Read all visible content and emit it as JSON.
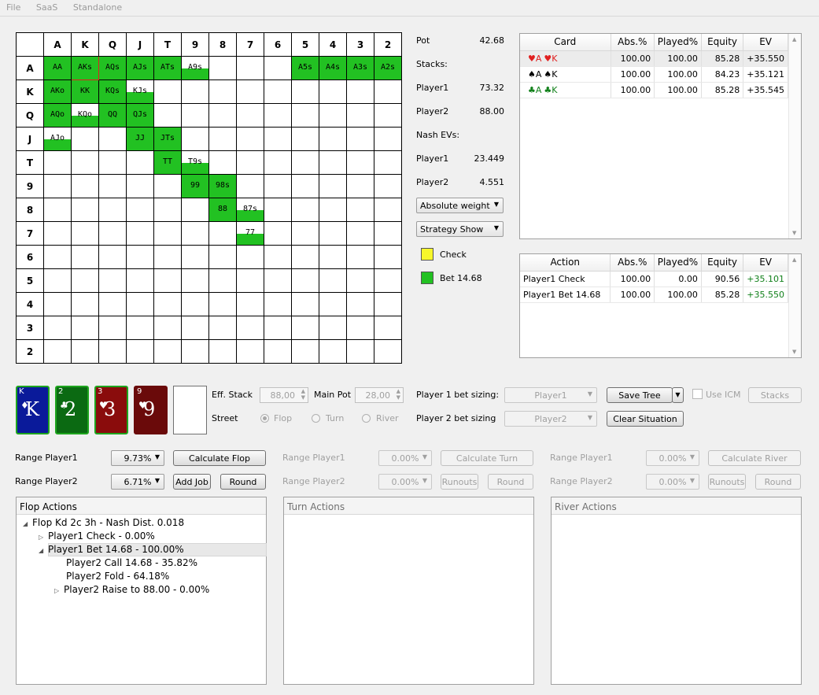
{
  "menu": [
    "File",
    "SaaS",
    "Standalone"
  ],
  "grid": {
    "headers": [
      "A",
      "K",
      "Q",
      "J",
      "T",
      "9",
      "8",
      "7",
      "6",
      "5",
      "4",
      "3",
      "2"
    ],
    "rows": [
      {
        "label": "A",
        "cells": [
          {
            "t": "AA",
            "f": 1
          },
          {
            "t": "AKs",
            "f": 1,
            "sel": true
          },
          {
            "t": "AQs",
            "f": 1
          },
          {
            "t": "AJs",
            "f": 1
          },
          {
            "t": "ATs",
            "f": 1
          },
          {
            "t": "A9s",
            "f": 0.5
          },
          {
            "t": "",
            "f": 0
          },
          {
            "t": "",
            "f": 0
          },
          {
            "t": "",
            "f": 0
          },
          {
            "t": "A5s",
            "f": 1
          },
          {
            "t": "A4s",
            "f": 1
          },
          {
            "t": "A3s",
            "f": 1
          },
          {
            "t": "A2s",
            "f": 1
          }
        ]
      },
      {
        "label": "K",
        "cells": [
          {
            "t": "AKo",
            "f": 1
          },
          {
            "t": "KK",
            "f": 1
          },
          {
            "t": "KQs",
            "f": 1
          },
          {
            "t": "KJs",
            "f": 0.5
          },
          {
            "t": "",
            "f": 0
          },
          {
            "t": "",
            "f": 0
          },
          {
            "t": "",
            "f": 0
          },
          {
            "t": "",
            "f": 0
          },
          {
            "t": "",
            "f": 0
          },
          {
            "t": "",
            "f": 0
          },
          {
            "t": "",
            "f": 0
          },
          {
            "t": "",
            "f": 0
          },
          {
            "t": "",
            "f": 0
          }
        ]
      },
      {
        "label": "Q",
        "cells": [
          {
            "t": "AQo",
            "f": 1
          },
          {
            "t": "KQo",
            "f": 0.5
          },
          {
            "t": "QQ",
            "f": 1
          },
          {
            "t": "QJs",
            "f": 1
          },
          {
            "t": "",
            "f": 0
          },
          {
            "t": "",
            "f": 0
          },
          {
            "t": "",
            "f": 0
          },
          {
            "t": "",
            "f": 0
          },
          {
            "t": "",
            "f": 0
          },
          {
            "t": "",
            "f": 0
          },
          {
            "t": "",
            "f": 0
          },
          {
            "t": "",
            "f": 0
          },
          {
            "t": "",
            "f": 0
          }
        ]
      },
      {
        "label": "J",
        "cells": [
          {
            "t": "AJo",
            "f": 0.5
          },
          {
            "t": "",
            "f": 0
          },
          {
            "t": "",
            "f": 0
          },
          {
            "t": "JJ",
            "f": 1
          },
          {
            "t": "JTs",
            "f": 1
          },
          {
            "t": "",
            "f": 0
          },
          {
            "t": "",
            "f": 0
          },
          {
            "t": "",
            "f": 0
          },
          {
            "t": "",
            "f": 0
          },
          {
            "t": "",
            "f": 0
          },
          {
            "t": "",
            "f": 0
          },
          {
            "t": "",
            "f": 0
          },
          {
            "t": "",
            "f": 0
          }
        ]
      },
      {
        "label": "T",
        "cells": [
          {
            "t": "",
            "f": 0
          },
          {
            "t": "",
            "f": 0
          },
          {
            "t": "",
            "f": 0
          },
          {
            "t": "",
            "f": 0
          },
          {
            "t": "TT",
            "f": 1
          },
          {
            "t": "T9s",
            "f": 0.5
          },
          {
            "t": "",
            "f": 0
          },
          {
            "t": "",
            "f": 0
          },
          {
            "t": "",
            "f": 0
          },
          {
            "t": "",
            "f": 0
          },
          {
            "t": "",
            "f": 0
          },
          {
            "t": "",
            "f": 0
          },
          {
            "t": "",
            "f": 0
          }
        ]
      },
      {
        "label": "9",
        "cells": [
          {
            "t": "",
            "f": 0
          },
          {
            "t": "",
            "f": 0
          },
          {
            "t": "",
            "f": 0
          },
          {
            "t": "",
            "f": 0
          },
          {
            "t": "",
            "f": 0
          },
          {
            "t": "99",
            "f": 1
          },
          {
            "t": "98s",
            "f": 1
          },
          {
            "t": "",
            "f": 0
          },
          {
            "t": "",
            "f": 0
          },
          {
            "t": "",
            "f": 0
          },
          {
            "t": "",
            "f": 0
          },
          {
            "t": "",
            "f": 0
          },
          {
            "t": "",
            "f": 0
          }
        ]
      },
      {
        "label": "8",
        "cells": [
          {
            "t": "",
            "f": 0
          },
          {
            "t": "",
            "f": 0
          },
          {
            "t": "",
            "f": 0
          },
          {
            "t": "",
            "f": 0
          },
          {
            "t": "",
            "f": 0
          },
          {
            "t": "",
            "f": 0
          },
          {
            "t": "88",
            "f": 1
          },
          {
            "t": "87s",
            "f": 0.5
          },
          {
            "t": "",
            "f": 0
          },
          {
            "t": "",
            "f": 0
          },
          {
            "t": "",
            "f": 0
          },
          {
            "t": "",
            "f": 0
          },
          {
            "t": "",
            "f": 0
          }
        ]
      },
      {
        "label": "7",
        "cells": [
          {
            "t": "",
            "f": 0
          },
          {
            "t": "",
            "f": 0
          },
          {
            "t": "",
            "f": 0
          },
          {
            "t": "",
            "f": 0
          },
          {
            "t": "",
            "f": 0
          },
          {
            "t": "",
            "f": 0
          },
          {
            "t": "",
            "f": 0
          },
          {
            "t": "77",
            "f": 0.5
          },
          {
            "t": "",
            "f": 0
          },
          {
            "t": "",
            "f": 0
          },
          {
            "t": "",
            "f": 0
          },
          {
            "t": "",
            "f": 0
          },
          {
            "t": "",
            "f": 0
          }
        ]
      },
      {
        "label": "6",
        "cells": []
      },
      {
        "label": "5",
        "cells": []
      },
      {
        "label": "4",
        "cells": []
      },
      {
        "label": "3",
        "cells": []
      },
      {
        "label": "2",
        "cells": []
      }
    ]
  },
  "info": {
    "pot_label": "Pot",
    "pot": "42.68",
    "stacks_label": "Stacks:",
    "p1_label": "Player1",
    "p1_stack": "73.32",
    "p2_label": "Player2",
    "p2_stack": "88.00",
    "nash_label": "Nash EVs:",
    "p1_ev_label": "Player1",
    "p1_ev": "23.449",
    "p2_ev_label": "Player2",
    "p2_ev": "4.551",
    "weight_combo": "Absolute weight",
    "strategy_combo": "Strategy Show",
    "legend_check": "Check",
    "legend_check_color": "#f7f72a",
    "legend_bet": "Bet 14.68",
    "legend_bet_color": "#22c122"
  },
  "card_table": {
    "headers": [
      "Card",
      "Abs.%",
      "Played%",
      "Equity",
      "EV"
    ],
    "rows": [
      {
        "s1": "♥",
        "r1": "A",
        "s2": "♥",
        "r2": "K",
        "color": "#e02020",
        "abs": "100.00",
        "played": "100.00",
        "equity": "85.28",
        "ev": "+35.550"
      },
      {
        "s1": "♠",
        "r1": "A",
        "s2": "♠",
        "r2": "K",
        "color": "#000000",
        "abs": "100.00",
        "played": "100.00",
        "equity": "84.23",
        "ev": "+35.121"
      },
      {
        "s1": "♣",
        "r1": "A",
        "s2": "♣",
        "r2": "K",
        "color": "#11801a",
        "abs": "100.00",
        "played": "100.00",
        "equity": "85.28",
        "ev": "+35.545"
      }
    ]
  },
  "action_table": {
    "headers": [
      "Action",
      "Abs.%",
      "Played%",
      "Equity",
      "EV"
    ],
    "rows": [
      {
        "action": "Player1 Check",
        "abs": "100.00",
        "played": "0.00",
        "equity": "90.56",
        "ev": "+35.101"
      },
      {
        "action": "Player1 Bet 14.68",
        "abs": "100.00",
        "played": "100.00",
        "equity": "85.28",
        "ev": "+35.550"
      }
    ]
  },
  "board": [
    {
      "rank": "K",
      "suit": "♦",
      "bg": "#0a1a9a"
    },
    {
      "rank": "2",
      "suit": "♣",
      "bg": "#0b6a12"
    },
    {
      "rank": "3",
      "suit": "♥",
      "bg": "#8a0c0c"
    },
    {
      "rank": "9",
      "suit": "♥",
      "bg": "#6a0a0a"
    }
  ],
  "settings": {
    "eff_stack_label": "Eff. Stack",
    "eff_stack": "88,00",
    "main_pot_label": "Main Pot",
    "main_pot": "28,00",
    "street_label": "Street",
    "flop": "Flop",
    "turn": "Turn",
    "river": "River",
    "p1_sizing_label": "Player 1 bet sizing:",
    "p1_sizing": "Player1",
    "p2_sizing_label": "Player 2 bet sizing",
    "p2_sizing": "Player2",
    "save_tree": "Save Tree",
    "clear_situation": "Clear Situation",
    "use_icm": "Use ICM",
    "stacks": "Stacks"
  },
  "flop_controls": {
    "range_p1_label": "Range Player1",
    "range_p1": "9.73%",
    "range_p2_label": "Range Player2",
    "range_p2": "6.71%",
    "calculate": "Calculate Flop",
    "add_job": "Add Job",
    "round": "Round"
  },
  "turn_controls": {
    "range_p1_label": "Range Player1",
    "range_p1": "0.00%",
    "range_p2_label": "Range Player2",
    "range_p2": "0.00%",
    "calculate": "Calculate Turn",
    "runouts": "Runouts",
    "round": "Round"
  },
  "river_controls": {
    "range_p1_label": "Range Player1",
    "range_p1": "0.00%",
    "range_p2_label": "Range Player2",
    "range_p2": "0.00%",
    "calculate": "Calculate River",
    "runouts": "Runouts",
    "round": "Round"
  },
  "flop_actions": {
    "title": "Flop Actions",
    "items": [
      "Flop Kd 2c 3h - Nash Dist. 0.018",
      "Player1 Check - 0.00%",
      "Player1 Bet 14.68 - 100.00%",
      "Player2 Call 14.68 - 35.82%",
      "Player2 Fold - 64.18%",
      "Player2 Raise to 88.00 - 0.00%"
    ]
  },
  "turn_actions": {
    "title": "Turn Actions"
  },
  "river_actions": {
    "title": "River Actions"
  }
}
